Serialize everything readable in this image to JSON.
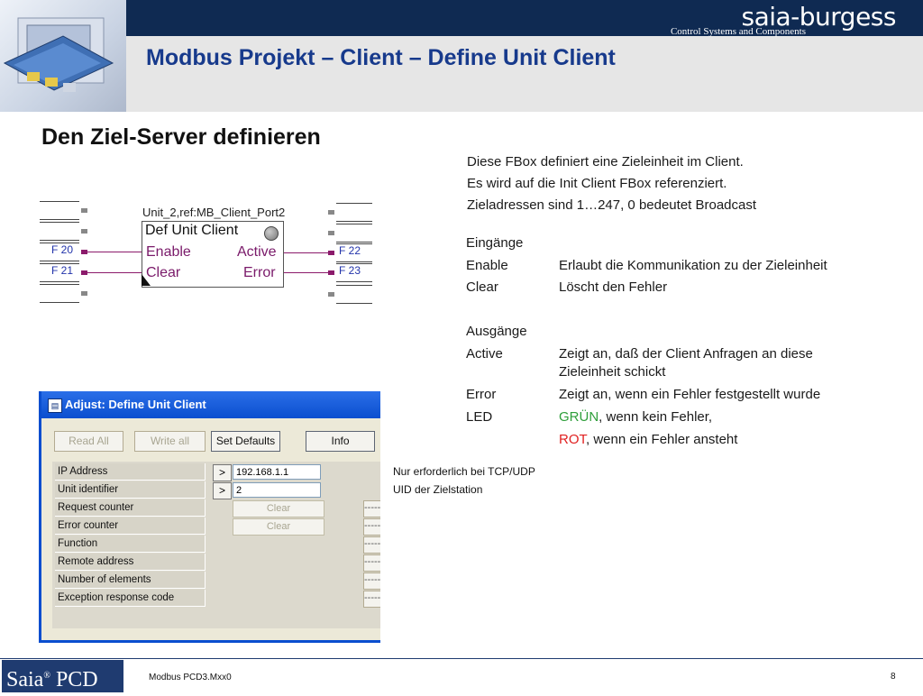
{
  "header": {
    "brand": "saia-burgess",
    "tagline": "Control Systems and Components",
    "title": "Modbus Projekt – Client – Define Unit Client"
  },
  "section_heading": "Den Ziel-Server definieren",
  "description": [
    "Diese FBox definiert eine Zieleinheit im Client.",
    "Es wird auf die Init Client FBox referenziert.",
    "Zieladressen sind 1…247, 0 bedeutet Broadcast"
  ],
  "inputs": {
    "heading": "Eingänge",
    "rows": [
      {
        "key": "Enable",
        "value": "Erlaubt die Kommunikation zu der Zieleinheit"
      },
      {
        "key": "Clear",
        "value": "Löscht den Fehler"
      }
    ]
  },
  "outputs": {
    "heading": "Ausgänge",
    "active": {
      "key": "Active",
      "value1": "Zeigt an, daß der Client Anfragen an diese",
      "value2": "Zieleinheit schickt"
    },
    "error": {
      "key": "Error",
      "value": "Zeigt an, wenn ein Fehler festgestellt wurde"
    },
    "led": {
      "key": "LED",
      "green_word": "GRÜN",
      "green_rest": ", wenn kein Fehler,",
      "red_word": "ROT",
      "red_rest": ", wenn ein Fehler ansteht"
    }
  },
  "colors": {
    "green": "#2e9e3a",
    "red": "#e02020",
    "title": "#173a8c",
    "header": "#0f2a52"
  },
  "fbox": {
    "ref": "Unit_2,ref:MB_Client_Port2",
    "title": "Def Unit Client",
    "in1": "Enable",
    "in2": "Clear",
    "out1": "Active",
    "out2": "Error",
    "left_flags": [
      "F 20",
      "F 21"
    ],
    "right_flags": [
      "F 22",
      "F 23"
    ]
  },
  "dialog": {
    "title": "Adjust: Define Unit Client",
    "buttons": [
      "Read All",
      "Write all",
      "Set Defaults",
      "Info"
    ],
    "rows": [
      {
        "label": "IP Address",
        "value": "192.168.1.1"
      },
      {
        "label": "Unit identifier",
        "value": "2"
      },
      {
        "label": "Request counter",
        "action": "Clear",
        "dash": "-----"
      },
      {
        "label": "Error counter",
        "action": "Clear",
        "dash": "-----"
      },
      {
        "label": "Function",
        "dash": "-----"
      },
      {
        "label": "Remote address",
        "dash": "-----"
      },
      {
        "label": "Number of elements",
        "dash": "-----"
      },
      {
        "label": "Exception response code",
        "dash": "-----"
      }
    ]
  },
  "notes": [
    "Nur erforderlich bei TCP/UDP",
    "UID der Zielstation"
  ],
  "footer": {
    "logo_main": "Saia",
    "logo_reg": "®",
    "logo_sub": " PCD",
    "text": "Modbus PCD3.Mxx0",
    "page": "8"
  }
}
